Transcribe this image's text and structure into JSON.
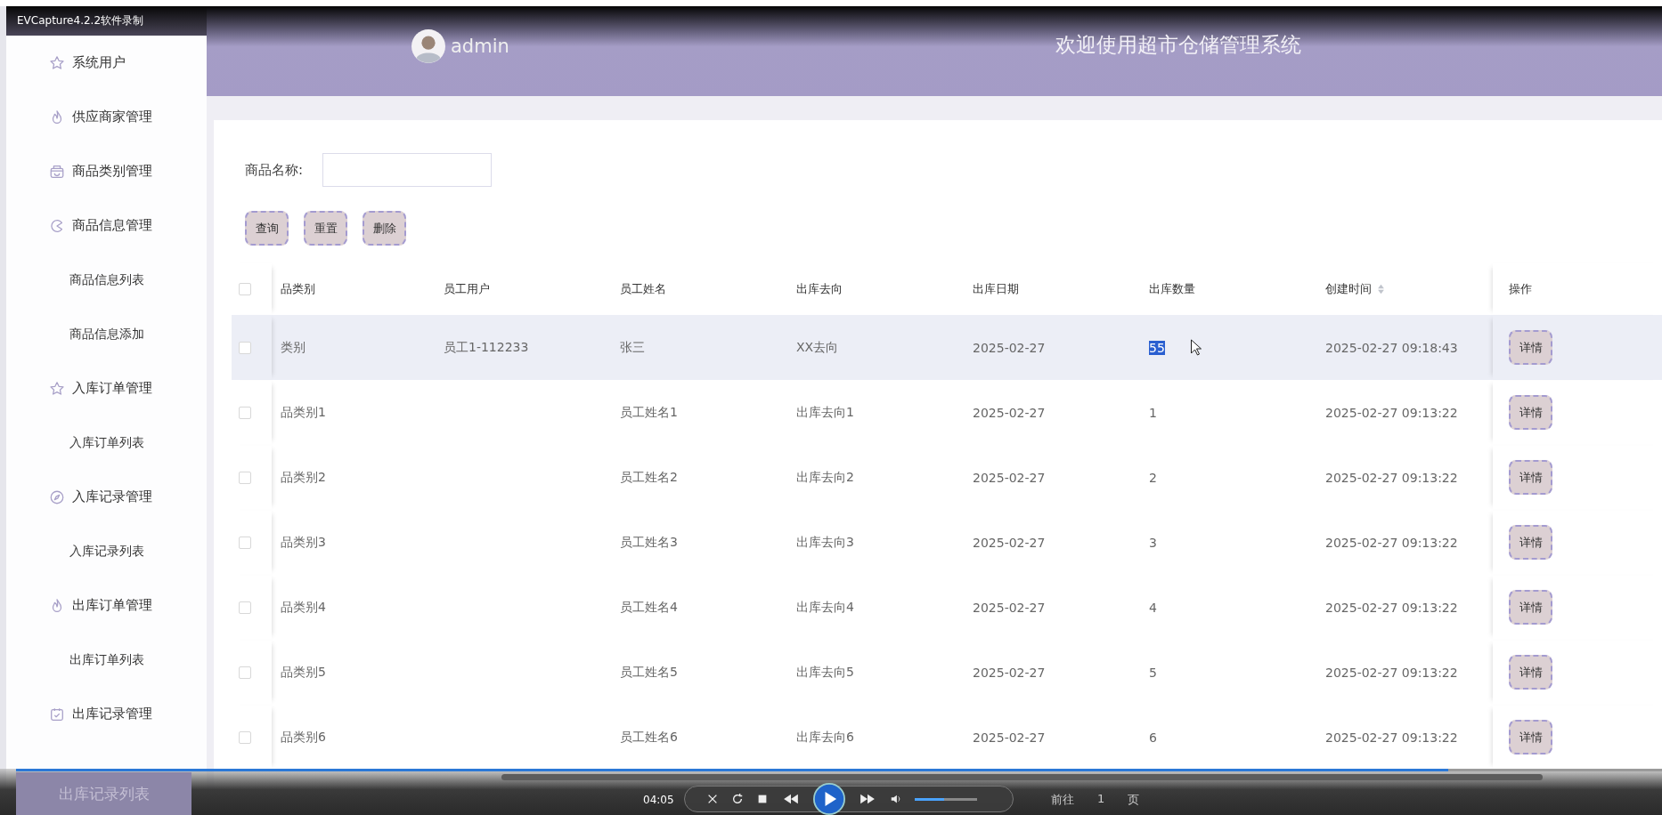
{
  "recorder": {
    "title": "EVCapture4.2.2软件录制",
    "time": "04:05",
    "level": 0.87,
    "volume": {
      "level": 0.47
    }
  },
  "sidebar": {
    "items": [
      {
        "label": "系统用户",
        "kind": "group",
        "selected": false
      },
      {
        "label": "供应商家管理",
        "kind": "group",
        "selected": false
      },
      {
        "label": "商品类别管理",
        "kind": "group",
        "selected": false
      },
      {
        "label": "商品信息管理",
        "kind": "group",
        "selected": false
      },
      {
        "label": "商品信息列表",
        "kind": "child",
        "selected": false
      },
      {
        "label": "商品信息添加",
        "kind": "child",
        "selected": false
      },
      {
        "label": "入库订单管理",
        "kind": "group",
        "selected": false
      },
      {
        "label": "入库订单列表",
        "kind": "child",
        "selected": false
      },
      {
        "label": "入库记录管理",
        "kind": "group",
        "selected": false
      },
      {
        "label": "入库记录列表",
        "kind": "child",
        "selected": false
      },
      {
        "label": "出库订单管理",
        "kind": "group",
        "selected": false
      },
      {
        "label": "出库订单列表",
        "kind": "child",
        "selected": false
      },
      {
        "label": "出库记录管理",
        "kind": "group",
        "selected": false
      },
      {
        "label": "出库记录列表",
        "kind": "child",
        "selected": true
      }
    ]
  },
  "header": {
    "user": "admin",
    "title": "欢迎使用超市仓储管理系统"
  },
  "search": {
    "label": "商品名称:"
  },
  "buttons": [
    "查询",
    "重置",
    "删除"
  ],
  "table": {
    "header_checked": false,
    "columns": [
      "品类别",
      "员工用户",
      "员工姓名",
      "出库去向",
      "出库日期",
      "出库数量",
      "创建时间",
      "操作"
    ],
    "rows": [
      {
        "checked": false,
        "highlighted": true,
        "category": "类别",
        "user": "员工1-112233",
        "name": "张三",
        "destination": "XX去向",
        "date": "2025-02-27",
        "quantity": "55",
        "quantity_selected": true,
        "created": "2025-02-27 09:18:43",
        "action": "详情"
      },
      {
        "checked": false,
        "highlighted": false,
        "category": "品类别1",
        "name": "员工姓名1",
        "destination": "出库去向1",
        "date": "2025-02-27",
        "quantity": "1",
        "quantity_selected": false,
        "created": "2025-02-27 09:13:22",
        "action": "详情"
      },
      {
        "checked": false,
        "highlighted": false,
        "category": "品类别2",
        "name": "员工姓名2",
        "destination": "出库去向2",
        "date": "2025-02-27",
        "quantity": "2",
        "quantity_selected": false,
        "created": "2025-02-27 09:13:22",
        "action": "详情"
      },
      {
        "checked": false,
        "highlighted": false,
        "category": "品类别3",
        "name": "员工姓名3",
        "destination": "出库去向3",
        "date": "2025-02-27",
        "quantity": "3",
        "quantity_selected": false,
        "created": "2025-02-27 09:13:22",
        "action": "详情"
      },
      {
        "checked": false,
        "highlighted": false,
        "category": "品类别4",
        "name": "员工姓名4",
        "destination": "出库去向4",
        "date": "2025-02-27",
        "quantity": "4",
        "quantity_selected": false,
        "created": "2025-02-27 09:13:22",
        "action": "详情"
      },
      {
        "checked": false,
        "highlighted": false,
        "category": "品类别5",
        "name": "员工姓名5",
        "destination": "出库去向5",
        "date": "2025-02-27",
        "quantity": "5",
        "quantity_selected": false,
        "created": "2025-02-27 09:13:22",
        "action": "详情"
      },
      {
        "checked": false,
        "highlighted": false,
        "category": "品类别6",
        "name": "员工姓名6",
        "destination": "出库去向6",
        "date": "2025-02-27",
        "quantity": "6",
        "quantity_selected": false,
        "created": "2025-02-27 09:13:22",
        "action": "详情"
      }
    ]
  },
  "pagination": {
    "goto_label": "前往",
    "goto_value": "1",
    "page_suffix": "页"
  }
}
